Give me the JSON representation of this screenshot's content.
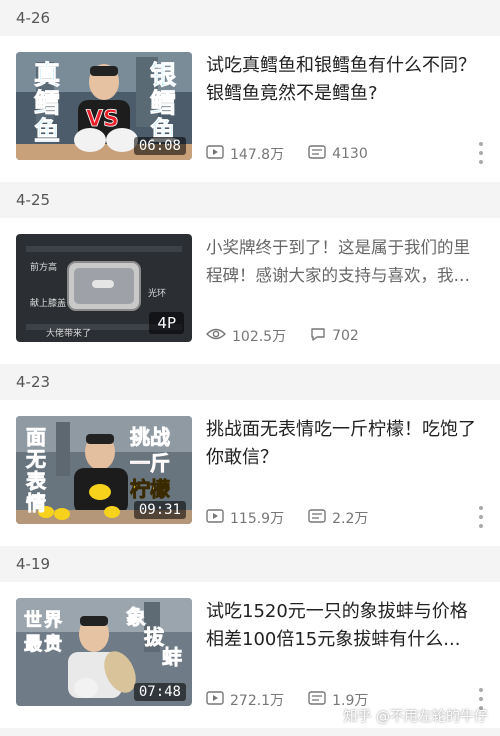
{
  "feed": [
    {
      "date": "4-26",
      "title": "试吃真鳕鱼和银鳕鱼有什么不同？银鳕鱼竟然不是鳕鱼?",
      "duration": "06:08",
      "plays": "147.8万",
      "comments": "4130",
      "comment_icon": "danmaku-icon",
      "thumb_texts": [
        "真",
        "鳕",
        "鱼",
        "银",
        "鳕",
        "鱼",
        "VS"
      ]
    },
    {
      "date": "4-25",
      "title": "小奖牌终于到了！这是属于我们的里程碑！感谢大家的支持与喜欢，我会努力做好每一期...",
      "badge": "4P",
      "plays": "102.5万",
      "comments": "702",
      "comment_icon": "comment-bubble-icon",
      "thumb_texts": [
        "前方高",
        "献上膝盖",
        "光环",
        "大佬带来了"
      ]
    },
    {
      "date": "4-23",
      "title": "挑战面无表情吃一斤柠檬！吃饱了你敢信？",
      "duration": "09:31",
      "plays": "115.9万",
      "comments": "2.2万",
      "comment_icon": "danmaku-icon",
      "thumb_texts": [
        "面",
        "无",
        "表",
        "情",
        "挑战",
        "一斤",
        "柠檬"
      ]
    },
    {
      "date": "4-19",
      "title": "试吃1520元一只的象拔蚌与价格相差100倍15元象拔蚌有什么...",
      "duration": "07:48",
      "plays": "272.1万",
      "comments": "1.9万",
      "comment_icon": "danmaku-icon",
      "thumb_texts": [
        "世",
        "界",
        "最",
        "贵",
        "象",
        "拔",
        "蚌"
      ]
    }
  ],
  "watermark": "知乎 @不用左轮的牛仔",
  "colors": {
    "thumb_text": "#1ec3ff",
    "thumb_red": "#e8202a",
    "accent": "#999999"
  }
}
